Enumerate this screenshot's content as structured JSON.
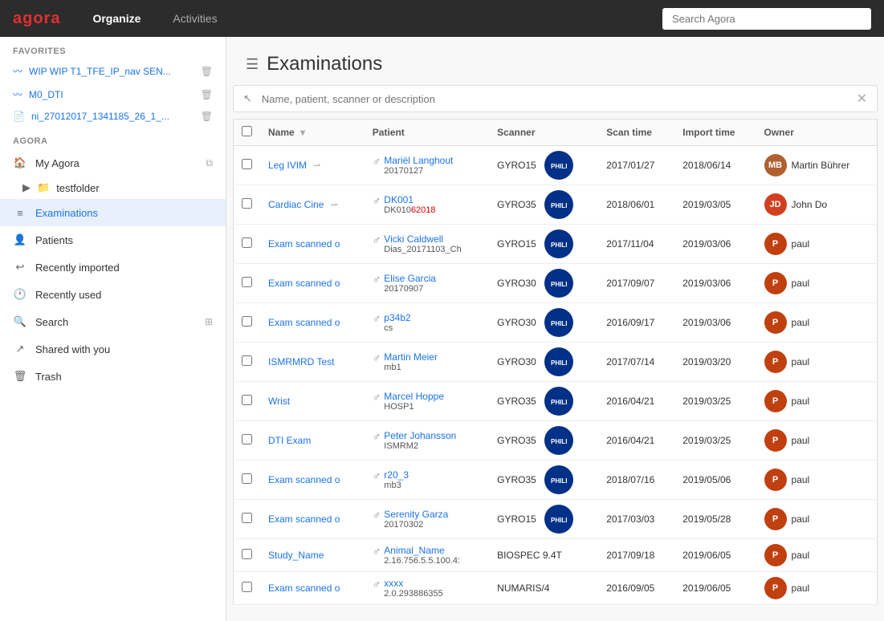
{
  "nav": {
    "logo": "agora",
    "links": [
      {
        "label": "Organize",
        "active": true
      },
      {
        "label": "Activities",
        "active": false
      }
    ],
    "search_placeholder": "Search Agora"
  },
  "sidebar": {
    "favorites_label": "FAVORITES",
    "favorites": [
      {
        "icon": "chart-icon",
        "label": "WIP WIP T1_TFE_IP_nav SEN..."
      },
      {
        "icon": "chart-icon",
        "label": "M0_DTI"
      },
      {
        "icon": "file-icon",
        "label": "ni_27012017_1341185_26_1_..."
      }
    ],
    "agora_label": "AGORA",
    "items": [
      {
        "icon": "home-icon",
        "label": "My Agora",
        "hasAction": true
      },
      {
        "icon": "folder-icon",
        "label": "testfolder",
        "indent": true
      },
      {
        "icon": "list-icon",
        "label": "Examinations",
        "active": true
      },
      {
        "icon": "person-icon",
        "label": "Patients"
      },
      {
        "icon": "import-icon",
        "label": "Recently imported"
      },
      {
        "icon": "clock-icon",
        "label": "Recently used"
      },
      {
        "icon": "search-icon",
        "label": "Search",
        "hasAction": true
      },
      {
        "icon": "share-icon",
        "label": "Shared with you"
      },
      {
        "icon": "trash-icon",
        "label": "Trash"
      }
    ]
  },
  "content": {
    "title": "Examinations",
    "filter_placeholder": "Name, patient, scanner or description",
    "columns": [
      "Name",
      "Patient",
      "Scanner",
      "Scan time",
      "Import time",
      "Owner"
    ],
    "rows": [
      {
        "name": "Leg IVIM",
        "share": true,
        "patient_name": "Mariël Langhout",
        "patient_id": "20170127",
        "scanner": "GYRO15",
        "scan_time": "2017/01/27",
        "import_time": "2018/06/14",
        "owner_initials": "MB",
        "owner_name": "Martin Bührer",
        "owner_color": "#b06030"
      },
      {
        "name": "Cardiac Cine",
        "share": true,
        "patient_name": "DK001",
        "patient_id": "DK01062018",
        "patient_id_highlight": true,
        "scanner": "GYRO35",
        "scan_time": "2018/06/01",
        "import_time": "2019/03/05",
        "owner_initials": "JD",
        "owner_name": "John Do",
        "owner_color": "#d04020"
      },
      {
        "name": "Exam scanned o",
        "share": false,
        "patient_name": "Vicki Caldwell",
        "patient_id": "Dias_20171103_Ch",
        "scanner": "GYRO15",
        "scan_time": "2017/11/04",
        "import_time": "2019/03/06",
        "owner_initials": "P",
        "owner_name": "paul",
        "owner_color": "#c04010"
      },
      {
        "name": "Exam scanned o",
        "share": false,
        "patient_name": "Elise Garcia",
        "patient_id": "20170907",
        "scanner": "GYRO30",
        "scan_time": "2017/09/07",
        "import_time": "2019/03/06",
        "owner_initials": "P",
        "owner_name": "paul",
        "owner_color": "#c04010"
      },
      {
        "name": "Exam scanned o",
        "share": false,
        "patient_name": "p34b2",
        "patient_id": "cs",
        "scanner": "GYRO30",
        "scan_time": "2016/09/17",
        "import_time": "2019/03/06",
        "owner_initials": "P",
        "owner_name": "paul",
        "owner_color": "#c04010"
      },
      {
        "name": "ISMRMRD Test",
        "share": false,
        "patient_name": "Martin Meier",
        "patient_id": "mb1",
        "scanner": "GYRO30",
        "scan_time": "2017/07/14",
        "import_time": "2019/03/20",
        "owner_initials": "P",
        "owner_name": "paul",
        "owner_color": "#c04010"
      },
      {
        "name": "Wrist",
        "share": false,
        "patient_name": "Marcel Hoppe",
        "patient_id": "HOSP1",
        "scanner": "GYRO35",
        "scan_time": "2016/04/21",
        "import_time": "2019/03/25",
        "owner_initials": "P",
        "owner_name": "paul",
        "owner_color": "#c04010"
      },
      {
        "name": "DTI Exam",
        "share": false,
        "patient_name": "Peter Johansson",
        "patient_id": "ISMRM2",
        "scanner": "GYRO35",
        "scan_time": "2016/04/21",
        "import_time": "2019/03/25",
        "owner_initials": "P",
        "owner_name": "paul",
        "owner_color": "#c04010"
      },
      {
        "name": "Exam scanned o",
        "share": false,
        "patient_name": "r20_3",
        "patient_id": "mb3",
        "scanner": "GYRO35",
        "scan_time": "2018/07/16",
        "import_time": "2019/05/06",
        "owner_initials": "P",
        "owner_name": "paul",
        "owner_color": "#c04010"
      },
      {
        "name": "Exam scanned o",
        "share": false,
        "patient_name": "Serenity Garza",
        "patient_id": "20170302",
        "scanner": "GYRO15",
        "scan_time": "2017/03/03",
        "import_time": "2019/05/28",
        "owner_initials": "P",
        "owner_name": "paul",
        "owner_color": "#c04010"
      },
      {
        "name": "Study_Name",
        "share": false,
        "patient_name": "Animal_Name",
        "patient_id": "2.16.756.5.5.100.4:",
        "scanner": "BIOSPEC 9.4T",
        "scan_time": "2017/09/18",
        "import_time": "2019/06/05",
        "owner_initials": "P",
        "owner_name": "paul",
        "owner_color": "#c04010"
      },
      {
        "name": "Exam scanned o",
        "share": false,
        "patient_name": "xxxx",
        "patient_id": "2.0.293886355",
        "scanner": "NUMARIS/4",
        "scan_time": "2016/09/05",
        "import_time": "2019/06/05",
        "owner_initials": "P",
        "owner_name": "paul",
        "owner_color": "#c04010"
      }
    ]
  }
}
